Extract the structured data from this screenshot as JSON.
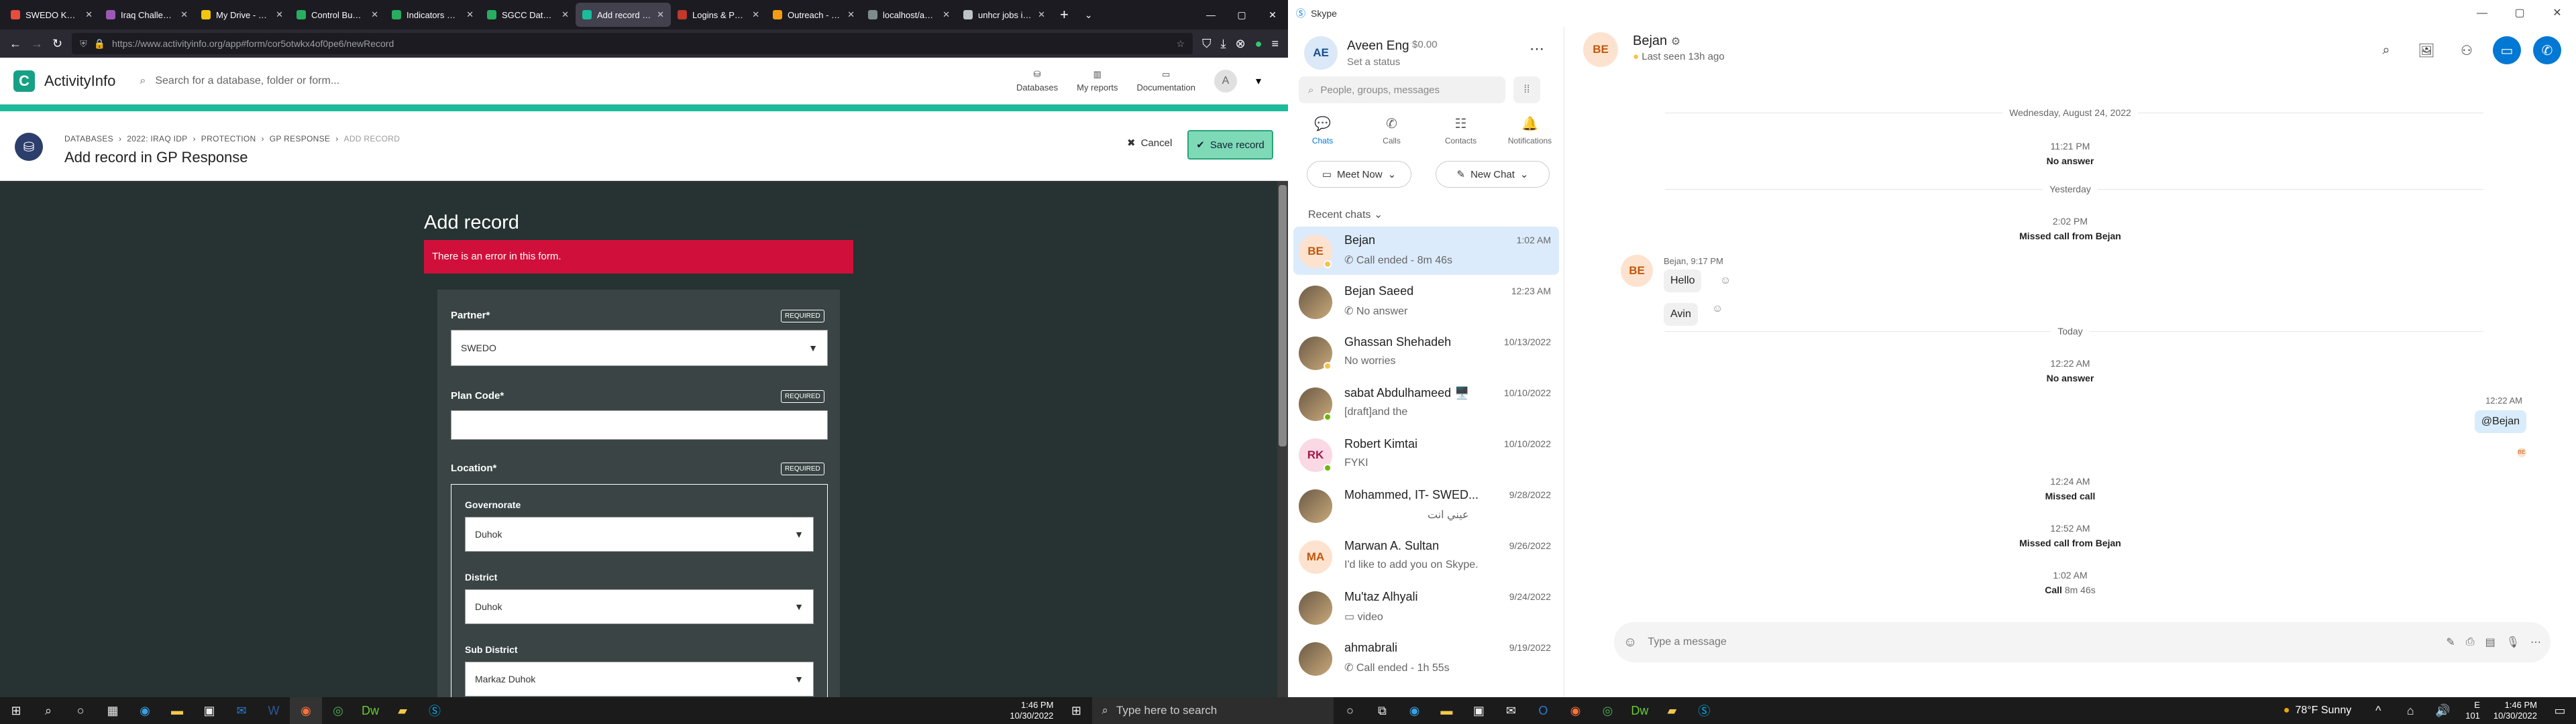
{
  "browser": {
    "tabs": [
      {
        "label": "SWEDO Knowled"
      },
      {
        "label": "Iraq Challenges"
      },
      {
        "label": "My Drive - Goog"
      },
      {
        "label": "Control Budget"
      },
      {
        "label": "Indicators Plan"
      },
      {
        "label": "SGCC Database"
      },
      {
        "label": "Add record - GP"
      },
      {
        "label": "Logins & Passw"
      },
      {
        "label": "Outreach - Pow"
      },
      {
        "label": "localhost/activityin"
      },
      {
        "label": "unhcr jobs iraq"
      }
    ],
    "url": "https://www.activityinfo.org/app#form/cor5otwkx4of0pe6/newRecord"
  },
  "app": {
    "brand": "ActivityInfo",
    "search_placeholder": "Search for a database, folder or form...",
    "nav": {
      "databases": "Databases",
      "reports": "My reports",
      "docs": "Documentation",
      "user_initial": "A"
    },
    "breadcrumbs": [
      "DATABASES",
      "2022: IRAQ IDP",
      "PROTECTION",
      "GP RESPONSE",
      "ADD RECORD"
    ],
    "page_title": "Add record in GP Response",
    "cancel": "Cancel",
    "save": "Save record",
    "form": {
      "heading": "Add record",
      "error": "There is an error in this form.",
      "required": "REQUIRED",
      "partner_label": "Partner*",
      "partner_value": "SWEDO",
      "plan_label": "Plan Code*",
      "location_label": "Location*",
      "gov_label": "Governorate",
      "gov_value": "Duhok",
      "district_label": "District",
      "district_value": "Duhok",
      "subdistrict_label": "Sub District",
      "subdistrict_value": "Markaz Duhok"
    }
  },
  "skype": {
    "window_title": "Skype",
    "user": {
      "initials": "AE",
      "name": "Aveen Eng",
      "balance": "$0.00",
      "status": "Set a status"
    },
    "search_placeholder": "People, groups, messages",
    "nav": [
      {
        "label": "Chats"
      },
      {
        "label": "Calls"
      },
      {
        "label": "Contacts"
      },
      {
        "label": "Notifications"
      }
    ],
    "meet_now": "Meet Now",
    "new_chat": "New Chat",
    "recent_label": "Recent chats",
    "chats": [
      {
        "initials": "BE",
        "name": "Bejan",
        "preview": "Call ended - 8m 46s",
        "time": "1:02 AM"
      },
      {
        "initials": "",
        "name": "Bejan Saeed",
        "preview": "No answer",
        "time": "12:23 AM"
      },
      {
        "initials": "",
        "name": "Ghassan Shehadeh",
        "preview": "No worries",
        "time": "10/13/2022"
      },
      {
        "initials": "",
        "name": "sabat Abdulhameed 🖥️",
        "preview": "[draft]and the",
        "time": "10/10/2022"
      },
      {
        "initials": "RK",
        "name": "Robert Kimtai",
        "preview": "FYKI",
        "time": "10/10/2022"
      },
      {
        "initials": "",
        "name": "Mohammed, IT- SWED...",
        "preview": "عيني انت",
        "time": "9/28/2022"
      },
      {
        "initials": "MA",
        "name": "Marwan A. Sultan",
        "preview": "I'd like to add you on Skype.",
        "time": "9/26/2022"
      },
      {
        "initials": "",
        "name": "Mu'taz Alhyali",
        "preview": "video",
        "time": "9/24/2022"
      },
      {
        "initials": "",
        "name": "ahmabrali",
        "preview": "Call ended - 1h 55s",
        "time": "9/19/2022"
      }
    ],
    "conversation": {
      "initials": "BE",
      "name": "Bejan",
      "last_seen": "Last seen 13h ago",
      "date1": "Wednesday, August 24, 2022",
      "t1": "11:21 PM",
      "m1": "No answer",
      "d2": "Yesterday",
      "t2": "2:02 PM",
      "m2": "Missed call from Bejan",
      "sender": "Bejan, 9:17 PM",
      "hello": "Hello",
      "avin": "Avin",
      "d3": "Today",
      "t3": "12:22 AM",
      "m3": "No answer",
      "t4": "12:22 AM",
      "mention": "@Bejan",
      "t5": "12:24 AM",
      "m5": "Missed call",
      "t6": "12:52 AM",
      "m6": "Missed call from Bejan",
      "t7": "1:02 AM",
      "m7a": "Call",
      "m7b": "8m 46s",
      "composer_placeholder": "Type a message"
    }
  },
  "taskbar": {
    "search_placeholder": "Type here to search",
    "time": "1:46 PM",
    "date": "10/30/2022",
    "weather": "78°F  Sunny",
    "lang": "E",
    "lang2": "101"
  }
}
